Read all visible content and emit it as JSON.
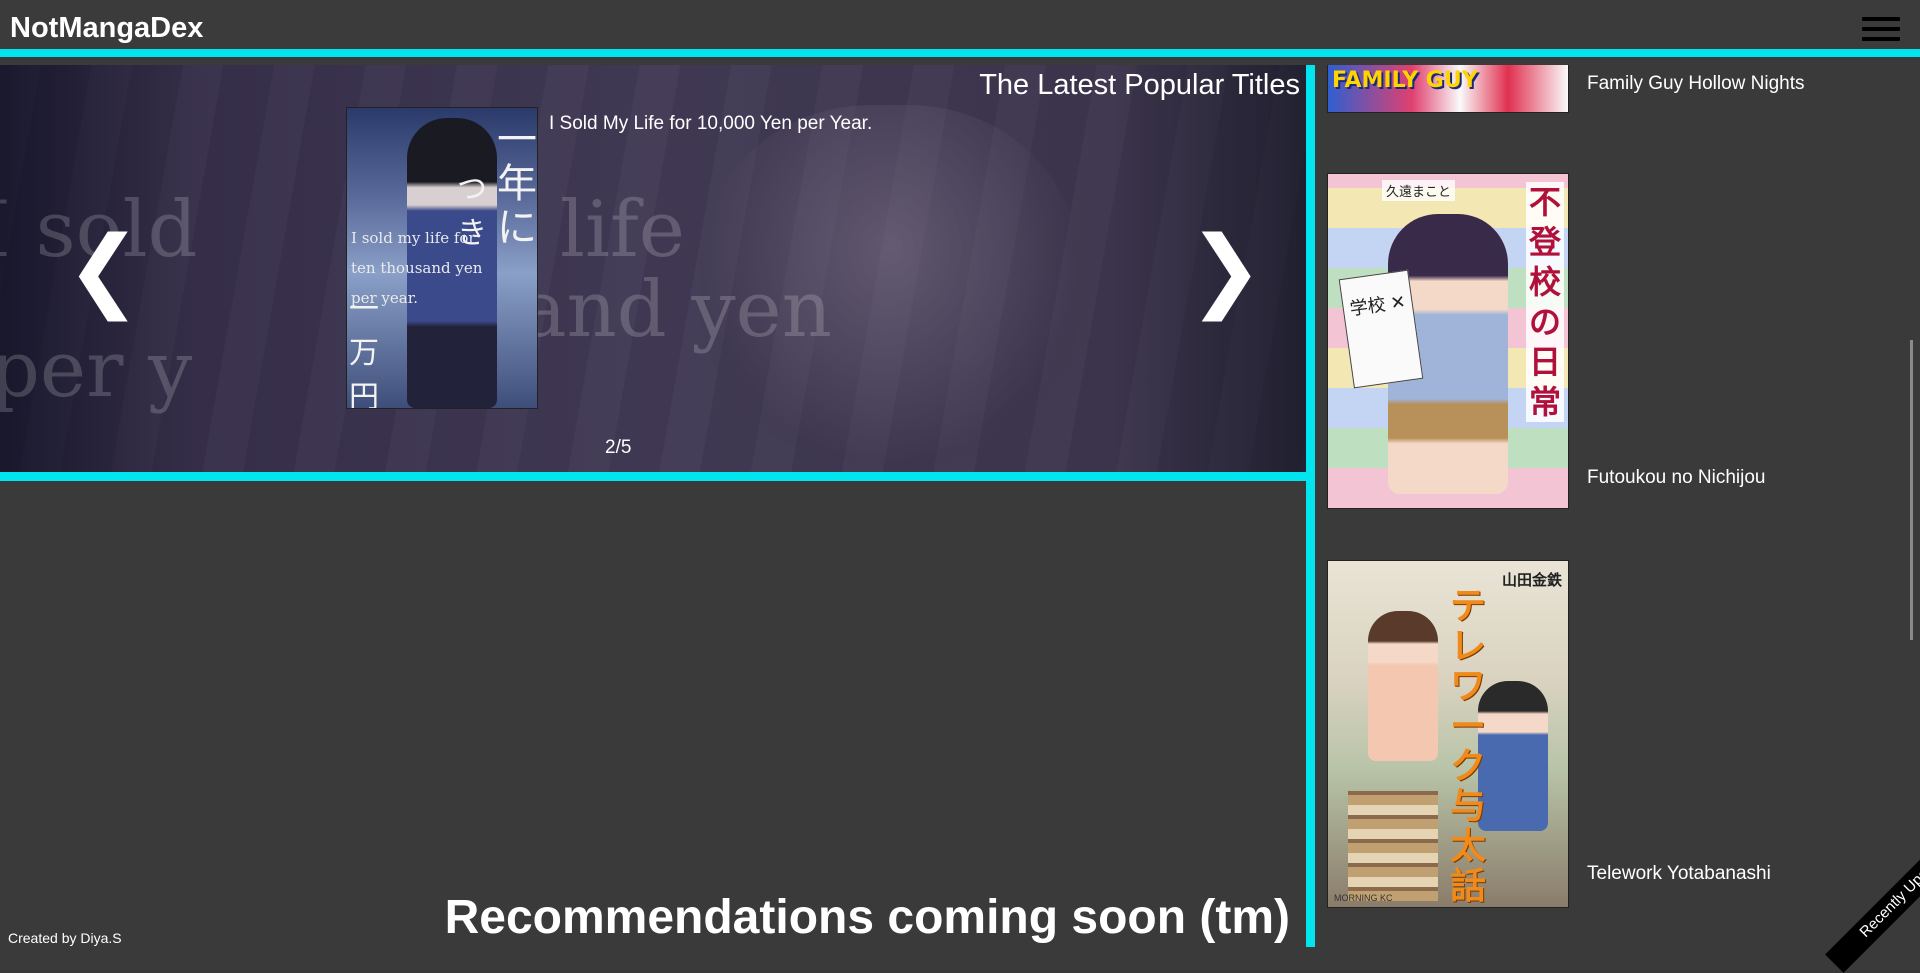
{
  "header": {
    "brand": "NotMangaDex",
    "menu_icon": "hamburger-menu-icon"
  },
  "carousel": {
    "heading": "The Latest Popular Titles",
    "slide_title": "I Sold My Life for 10,000 Yen per Year.",
    "counter": "2/5",
    "prev_symbol": "❮",
    "next_symbol": "❯",
    "cover_jp_1": "一年に",
    "cover_jp_2": "つき",
    "cover_jp_3": "一万円で。",
    "cover_en": "I sold my life for ten thousand yen per year."
  },
  "main": {
    "recommendations": "Recommendations coming soon (tm)"
  },
  "footer": {
    "credit": "Created by Diya.S"
  },
  "sidebar": {
    "ribbon": "Recently Updated",
    "items": [
      {
        "title": "Family Guy Hollow Nights",
        "cover_text": "FAMILY GUY"
      },
      {
        "title": "Futoukou no Nichijou",
        "cover_title_jp": "不登校の日常",
        "cover_author": "久遠まこと",
        "cover_sign": "学校 ✕"
      },
      {
        "title": "Telework Yotabanashi",
        "cover_title_jp": "テレワーク与太話",
        "cover_author": "山田金鉄",
        "cover_footer": "MORNING KC"
      }
    ]
  },
  "colors": {
    "accent": "#00e5ee",
    "background": "#3a3a3a"
  }
}
